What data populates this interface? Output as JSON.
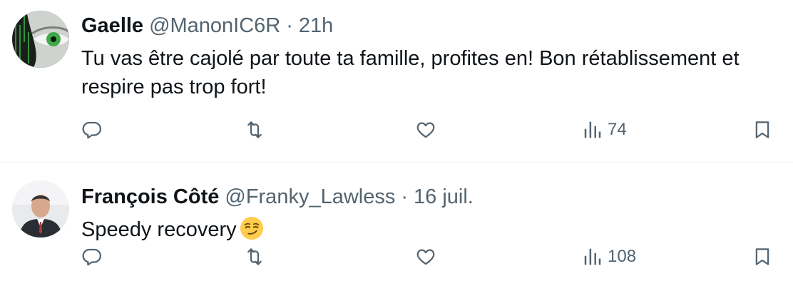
{
  "replies": [
    {
      "name": "Gaelle",
      "handle": "@ManonIC6R",
      "separator": "·",
      "time": "21h",
      "text": "Tu vas être cajolé par toute ta famille, profites en! Bon rétablissement et respire pas trop fort!",
      "views": "74",
      "avatar_icon": "green-eye-matrix-avatar"
    },
    {
      "name": "François Côté",
      "handle": "@Franky_Lawless",
      "separator": "·",
      "time": "16 juil.",
      "text": "Speedy recovery",
      "emoji": "smirking-face-emoji",
      "views": "108",
      "avatar_icon": "man-in-suit-avatar"
    }
  ],
  "icons": {
    "reply": "reply-icon",
    "retweet": "retweet-icon",
    "like": "like-icon",
    "views": "views-icon",
    "bookmark": "bookmark-icon"
  },
  "colors": {
    "text": "#0f1419",
    "secondary": "#536471",
    "divider": "#eff3f4"
  }
}
